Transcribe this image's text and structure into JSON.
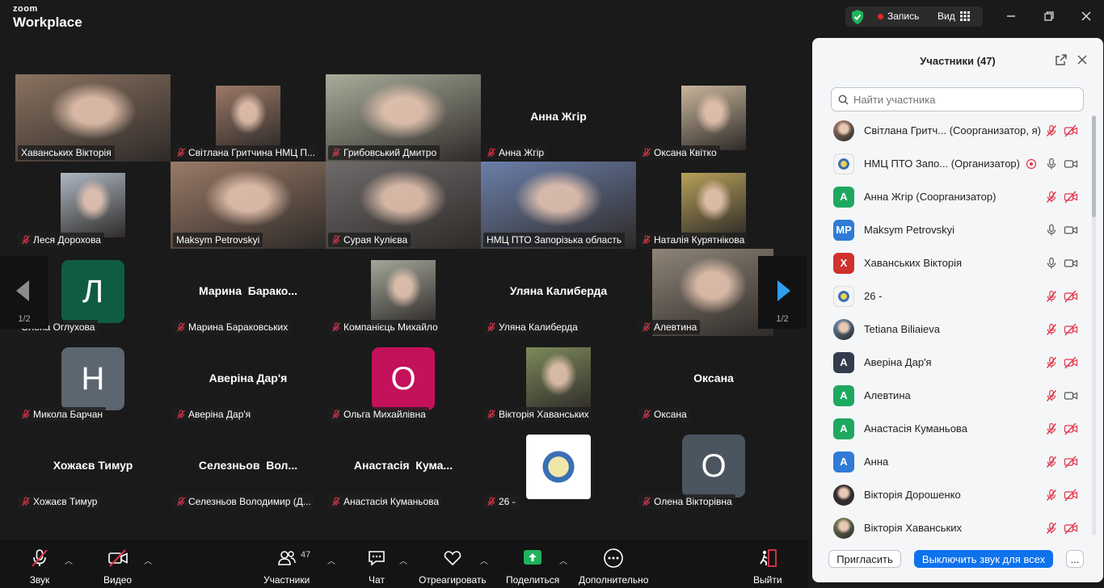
{
  "app": {
    "brand_top": "zoom",
    "brand_bottom": "Workplace",
    "record_label": "Запись",
    "view_label": "Вид"
  },
  "grid": {
    "page_indicator_left": "1/2",
    "page_indicator_right": "1/2",
    "tiles": [
      {
        "name": "Хаванських Вікторія",
        "kind": "photo",
        "muted": false,
        "bg": "#8a7260"
      },
      {
        "name": "Світлана Гритчина НМЦ П...",
        "kind": "photo",
        "muted": true,
        "bg": "#9b7867"
      },
      {
        "name": "Грибовський Дмитро",
        "kind": "photo",
        "muted": true,
        "bg": "#a9ad9a"
      },
      {
        "name": "Анна Жгір",
        "kind": "text",
        "muted": true,
        "big": "Анна Жгір"
      },
      {
        "name": "Оксана Квітко",
        "kind": "photo",
        "muted": true,
        "bg": "#c9b79d"
      },
      {
        "name": "Леся Дорохова",
        "kind": "photo",
        "muted": true,
        "bg": "#aeb8c4"
      },
      {
        "name": "Maksym Petrovskyi",
        "kind": "photo",
        "muted": false,
        "bg": "#9a7a67"
      },
      {
        "name": "Сурая Кулієва",
        "kind": "photo",
        "muted": true,
        "bg": "#6f6a6b"
      },
      {
        "name": "НМЦ ПТО Запорізька область",
        "kind": "photo",
        "muted": false,
        "bg": "#6b7faa",
        "active": true
      },
      {
        "name": "Наталія Курятнікова",
        "kind": "photo",
        "muted": true,
        "bg": "#b6a15a"
      },
      {
        "name": "Олена Оглухова",
        "kind": "avatar",
        "muted": false,
        "letter": "Л",
        "color": "#0f5c45"
      },
      {
        "name": "Марина Бараковських",
        "kind": "text",
        "muted": true,
        "big": "Марина  Барако..."
      },
      {
        "name": "Компанієць Михайло",
        "kind": "photo",
        "muted": true,
        "bg": "#a4a79a"
      },
      {
        "name": "Уляна Калиберда",
        "kind": "text",
        "muted": true,
        "big": "Уляна Калиберда"
      },
      {
        "name": "Алевтина",
        "kind": "photo",
        "muted": true,
        "bg": "#8f8578"
      },
      {
        "name": "Микола Барчан",
        "kind": "avatar",
        "muted": true,
        "letter": "Н",
        "color": "#5c6670"
      },
      {
        "name": "Аверіна Дар'я",
        "kind": "text",
        "muted": true,
        "big": "Аверіна Дар'я"
      },
      {
        "name": "Ольга Михайлівна",
        "kind": "avatar",
        "muted": true,
        "letter": "О",
        "color": "#c4115b"
      },
      {
        "name": "Вікторія Хаванських",
        "kind": "photo",
        "muted": true,
        "bg": "#7d8a5b"
      },
      {
        "name": "Оксана",
        "kind": "text",
        "muted": true,
        "big": "Оксана"
      },
      {
        "name": "Хожаєв Тимур",
        "kind": "text",
        "muted": true,
        "big": "Хожаєв Тимур"
      },
      {
        "name": "Селезньов Володимир (Д...",
        "kind": "text",
        "muted": true,
        "big": "Селезньов  Вол..."
      },
      {
        "name": "Анастасія Куманьова",
        "kind": "text",
        "muted": true,
        "big": "Анастасія  Кума..."
      },
      {
        "name": "26 -",
        "kind": "logo",
        "muted": true
      },
      {
        "name": "Олена Вікторівна",
        "kind": "avatar",
        "muted": true,
        "letter": "О",
        "color": "#4b5560"
      }
    ]
  },
  "toolbar": {
    "audio": "Звук",
    "video": "Видео",
    "participants": "Участники",
    "participants_count": "47",
    "chat": "Чат",
    "react": "Отреагировать",
    "share": "Поделиться",
    "more": "Дополнительно",
    "leave": "Выйти"
  },
  "panel": {
    "title": "Участники (47)",
    "search_placeholder": "Найти участника",
    "invite": "Пригласить",
    "unmute_all": "Выключить звук для всех",
    "more": "...",
    "participants": [
      {
        "name": "Світлана Гритч...",
        "role": "(Соорганизатор, я)",
        "avatar": "photo",
        "bg": "#a97d6a",
        "mic": "muted",
        "cam": "off"
      },
      {
        "name": "НМЦ ПТО Запо...",
        "role": "(Организатор)",
        "avatar": "logo",
        "bg": "#ffffff",
        "mic": "on",
        "cam": "on",
        "sharing": true
      },
      {
        "name": "Анна Жгір",
        "role": "(Соорганизатор)",
        "avatar": "letter",
        "letter": "А",
        "bg": "#1ea85f",
        "mic": "muted",
        "cam": "off"
      },
      {
        "name": "Maksym Petrovskyi",
        "role": "",
        "avatar": "letter",
        "letter": "MP",
        "bg": "#2f7bd6",
        "mic": "on",
        "cam": "on"
      },
      {
        "name": "Хаванських Вікторія",
        "role": "",
        "avatar": "letter",
        "letter": "Х",
        "bg": "#d0312d",
        "mic": "on",
        "cam": "on"
      },
      {
        "name": "26 -",
        "role": "",
        "avatar": "logo",
        "bg": "#ffffff",
        "mic": "muted",
        "cam": "off"
      },
      {
        "name": "Tetiana Biliaieva",
        "role": "",
        "avatar": "photo",
        "bg": "#6a8db0",
        "mic": "muted",
        "cam": "off"
      },
      {
        "name": "Аверіна Дар'я",
        "role": "",
        "avatar": "letter",
        "letter": "А",
        "bg": "#333c4d",
        "mic": "muted",
        "cam": "off"
      },
      {
        "name": "Алевтина",
        "role": "",
        "avatar": "letter",
        "letter": "А",
        "bg": "#1ea85f",
        "mic": "muted",
        "cam": "on"
      },
      {
        "name": "Анастасія Куманьова",
        "role": "",
        "avatar": "letter",
        "letter": "А",
        "bg": "#1ea85f",
        "mic": "muted",
        "cam": "off"
      },
      {
        "name": "Анна",
        "role": "",
        "avatar": "letter",
        "letter": "А",
        "bg": "#2f7bd6",
        "mic": "muted",
        "cam": "off"
      },
      {
        "name": "Вікторія Дорошенко",
        "role": "",
        "avatar": "photo",
        "bg": "#3a3030",
        "mic": "muted",
        "cam": "off"
      },
      {
        "name": "Вікторія Хаванських",
        "role": "",
        "avatar": "photo",
        "bg": "#7d8a5b",
        "mic": "muted",
        "cam": "off"
      }
    ]
  },
  "colors": {
    "accent": "#0e72ed",
    "active_speaker": "#2ec48b",
    "muted_red": "#e0364a",
    "share_green": "#1fb25a"
  },
  "icons": [
    "shield-icon",
    "grid-icon",
    "mic-off-icon",
    "mic-icon",
    "video-off-icon",
    "video-icon",
    "participants-icon",
    "chat-icon",
    "heart-icon",
    "share-icon",
    "more-icon",
    "leave-icon",
    "popout-icon",
    "close-icon",
    "search-icon"
  ]
}
